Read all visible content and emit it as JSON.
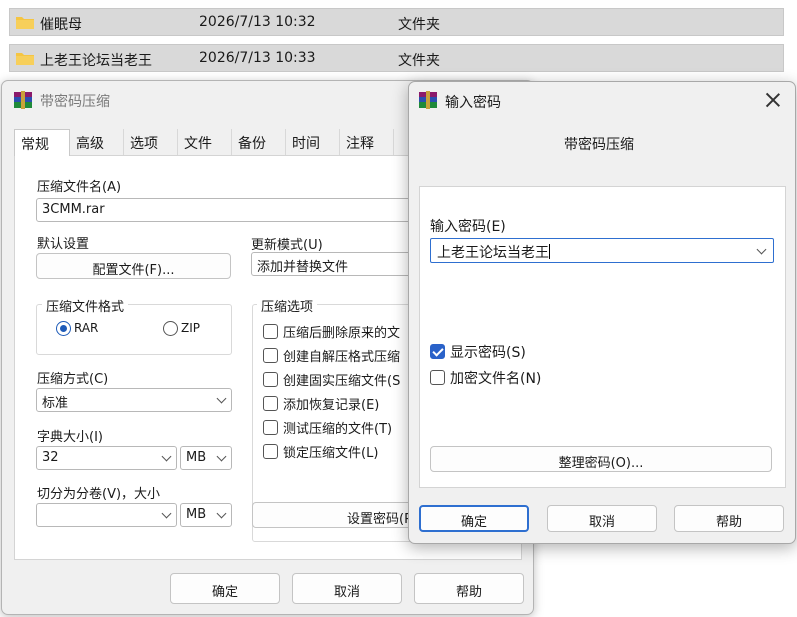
{
  "explorer": {
    "rows": [
      {
        "name": "催眠母",
        "date": "2026/7/13 10:32",
        "type": "文件夹"
      },
      {
        "name": "上老王论坛当老王",
        "date": "2026/7/13 10:33",
        "type": "文件夹"
      }
    ],
    "folder_color": "#f5c542"
  },
  "main_dialog": {
    "title": "带密码压缩",
    "tabs": [
      "常规",
      "高级",
      "选项",
      "文件",
      "备份",
      "时间",
      "注释"
    ],
    "archive_name_label": "压缩文件名(A)",
    "archive_name_value": "3CMM.rar",
    "default_settings_label": "默认设置",
    "profiles_button": "配置文件(F)...",
    "update_mode_label": "更新模式(U)",
    "update_mode_value": "添加并替换文件",
    "format_group_title": "压缩文件格式",
    "format_rar": "RAR",
    "format_zip": "ZIP",
    "options_group_title": "压缩选项",
    "options": [
      {
        "label": "压缩后删除原来的文",
        "checked": false
      },
      {
        "label": "创建自解压格式压缩",
        "checked": false
      },
      {
        "label": "创建固实压缩文件(S",
        "checked": false
      },
      {
        "label": "添加恢复记录(E)",
        "checked": false
      },
      {
        "label": "测试压缩的文件(T)",
        "checked": false
      },
      {
        "label": "锁定压缩文件(L)",
        "checked": false
      }
    ],
    "method_label": "压缩方式(C)",
    "method_value": "标准",
    "dict_label": "字典大小(I)",
    "dict_value": "32",
    "dict_unit": "MB",
    "split_label": "切分为分卷(V)，大小",
    "split_value": "",
    "split_unit": "MB",
    "set_password_button": "设置密码(P)",
    "ok_button": "确定",
    "cancel_button": "取消",
    "help_button": "帮助"
  },
  "password_dialog": {
    "title": "输入密码",
    "subtitle": "带密码压缩",
    "password_label": "输入密码(E)",
    "password_value": "上老王论坛当老王",
    "show_password_label": "显示密码(S)",
    "show_password_checked": true,
    "encrypt_names_label": "加密文件名(N)",
    "encrypt_names_checked": false,
    "organize_button": "整理密码(O)...",
    "ok_button": "确定",
    "cancel_button": "取消",
    "help_button": "帮助",
    "accent_color": "#2e6fd0"
  }
}
